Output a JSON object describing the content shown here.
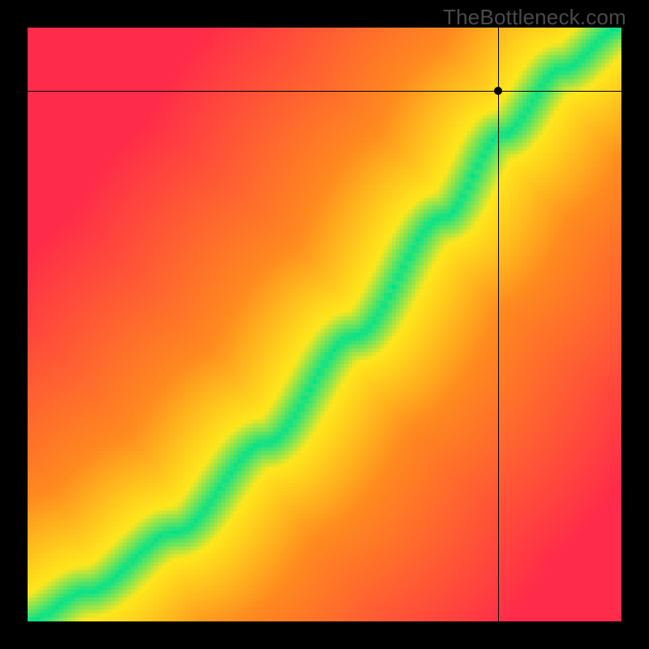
{
  "attribution": "TheBottleneck.com",
  "colors": {
    "red": "#ff2b4a",
    "orange": "#ff8a1f",
    "yellow": "#ffe71c",
    "green": "#00e28c",
    "black": "#000000"
  },
  "chart_data": {
    "type": "heatmap",
    "title": "",
    "xlabel": "",
    "ylabel": "",
    "xlim": [
      0,
      1
    ],
    "ylim": [
      0,
      1
    ],
    "grid": false,
    "legend": false,
    "description": "Heat-map of bottleneck severity. Color encodes distance of each (x,y) point from a diagonal optimal curve; green = on curve (balanced), transitioning through yellow and orange to red = far from curve (bottlenecked). Overlaid crosshair marks a specific point.",
    "optimal_curve": {
      "note": "normalized control points (x,y) in [0,1] describing the green ridge / optimal-pairing curve",
      "points": [
        [
          0.0,
          0.0
        ],
        [
          0.1,
          0.05
        ],
        [
          0.25,
          0.15
        ],
        [
          0.4,
          0.3
        ],
        [
          0.55,
          0.48
        ],
        [
          0.7,
          0.68
        ],
        [
          0.8,
          0.82
        ],
        [
          0.9,
          0.93
        ],
        [
          1.0,
          1.0
        ]
      ]
    },
    "colormap_stops": [
      {
        "d": 0.0,
        "color": "#00e28c"
      },
      {
        "d": 0.045,
        "color": "#ffe71c"
      },
      {
        "d": 0.18,
        "color": "#ff8a1f"
      },
      {
        "d": 0.5,
        "color": "#ff2b4a"
      }
    ],
    "marker": {
      "x": 0.793,
      "y": 0.893
    },
    "resolution": 150
  }
}
